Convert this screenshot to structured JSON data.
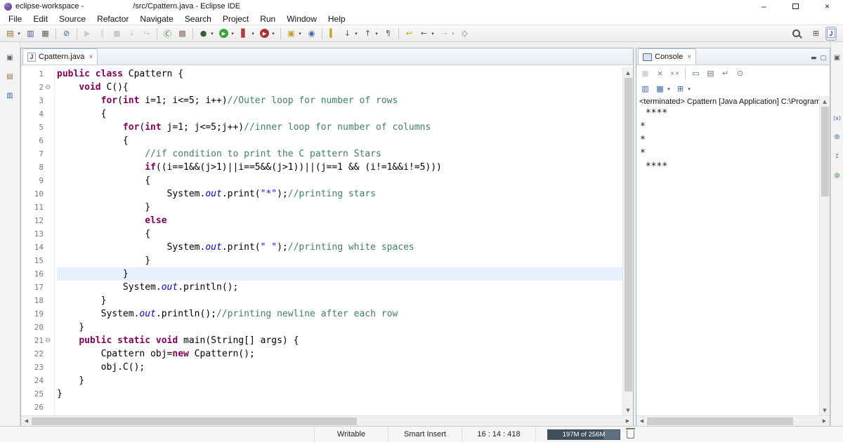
{
  "window": {
    "title_workspace": "eclipse-workspace -",
    "title_file": "/src/Cpattern.java - Eclipse IDE"
  },
  "ui": {
    "dropdown_glyph": "▾",
    "close_glyph": "×",
    "minimize_glyph": "–",
    "up_glyph": "▲",
    "down_glyph": "▼",
    "left_glyph": "◀",
    "right_glyph": "▶",
    "minimize_view_glyph": "▬",
    "maximize_view_glyph": "□",
    "open_perspective_glyph": "⊞",
    "java_glyph": "J"
  },
  "colors": {
    "keyword": "#7f0055",
    "comment": "#3f7f5f",
    "string": "#2a00ff",
    "field": "#0000c0",
    "current_line": "#e6f1fb"
  },
  "menu": {
    "items": [
      "File",
      "Edit",
      "Source",
      "Refactor",
      "Navigate",
      "Search",
      "Project",
      "Run",
      "Window",
      "Help"
    ]
  },
  "toolbar": {
    "buttons": [
      {
        "name": "new-wizard",
        "glyph": "▤",
        "color": "#8a6d2a",
        "dd": true
      },
      {
        "name": "save",
        "glyph": "▥",
        "color": "#4a4a8f"
      },
      {
        "name": "print",
        "glyph": "▦",
        "color": "#5a5a5a"
      },
      {
        "sep": true
      },
      {
        "name": "skip-all-breakpoints",
        "glyph": "⊘",
        "color": "#3465a4"
      },
      {
        "sep": true
      },
      {
        "name": "resume",
        "glyph": "▶",
        "color": "#8f8f8f",
        "disabled": true
      },
      {
        "name": "suspend",
        "glyph": "∥",
        "color": "#8f8f8f",
        "disabled": true
      },
      {
        "name": "terminate",
        "glyph": "■",
        "color": "#8f8f8f",
        "disabled": true
      },
      {
        "name": "step-into",
        "glyph": "↓",
        "color": "#8f8f8f",
        "disabled": true
      },
      {
        "name": "step-over",
        "glyph": "↪",
        "color": "#8f8f8f",
        "disabled": true
      },
      {
        "sep": true
      },
      {
        "name": "new-java-class",
        "glyph": "Ⓒ",
        "color": "#2e7d32"
      },
      {
        "name": "new-java-package",
        "glyph": "▩",
        "color": "#8d6e63"
      },
      {
        "sep": true
      },
      {
        "name": "debug",
        "glyph": "●",
        "color": "#355e3b",
        "dd": true
      },
      {
        "name": "run",
        "glyph": "▶",
        "color": "#ffffff",
        "bg": "#3aa33a",
        "dd": true
      },
      {
        "name": "coverage",
        "glyph": "▋",
        "color": "#b23b3b",
        "dd": true
      },
      {
        "name": "run-external-tools",
        "glyph": "▶",
        "color": "#ffffff",
        "bg": "#aa3333",
        "dd": true
      },
      {
        "sep": true
      },
      {
        "name": "open-task",
        "glyph": "▣",
        "color": "#c49a2a",
        "dd": true
      },
      {
        "name": "search",
        "glyph": "◉",
        "color": "#3465a4"
      },
      {
        "sep": true
      },
      {
        "name": "toggle-mark-occurrences",
        "glyph": "▍",
        "color": "#c8a415"
      },
      {
        "name": "next-annotation",
        "glyph": "↓",
        "color": "#555555",
        "dd": true
      },
      {
        "name": "previous-annotation",
        "glyph": "↑",
        "color": "#555555",
        "dd": true
      },
      {
        "name": "show-whitespace",
        "glyph": "¶",
        "color": "#777777"
      },
      {
        "sep": true
      },
      {
        "name": "last-edit-location",
        "glyph": "↩",
        "color": "#c8a415"
      },
      {
        "name": "back",
        "glyph": "←",
        "color": "#555555",
        "dd": true
      },
      {
        "name": "forward",
        "glyph": "→",
        "color": "#9a9a9a",
        "dd": true,
        "disabled": true
      },
      {
        "name": "pin-editor",
        "glyph": "◇",
        "color": "#777777"
      }
    ]
  },
  "left_strip": {
    "icons": [
      {
        "name": "restore-left-panel",
        "glyph": "▣",
        "color": "#556070"
      },
      {
        "name": "package-explorer",
        "glyph": "▤",
        "color": "#8d6e3f"
      },
      {
        "name": "open-type-hierarchy",
        "glyph": "▥",
        "color": "#3465a4"
      }
    ]
  },
  "right_strip": {
    "icons": [
      {
        "name": "restore-right-panel",
        "glyph": "▣",
        "color": "#556070"
      },
      {
        "sep": true,
        "size": 52
      },
      {
        "name": "variables-view",
        "glyph": "(x)",
        "color": "#3465a4",
        "small": true
      },
      {
        "name": "breakpoints-view",
        "glyph": "⊚",
        "color": "#3465a4"
      },
      {
        "name": "expressions-view",
        "glyph": "Σ",
        "color": "#777777",
        "small": true
      },
      {
        "name": "javadoc-view",
        "glyph": "@",
        "color": "#2a7a2a",
        "small": true
      }
    ]
  },
  "editor": {
    "tab_label": "Cpattern.java",
    "fold_glyph": "⊖",
    "lines": [
      {
        "n": 1,
        "seg": [
          [
            "k",
            "public"
          ],
          [
            "t",
            " "
          ],
          [
            "k",
            "class"
          ],
          [
            "t",
            " Cpattern {"
          ]
        ]
      },
      {
        "n": 2,
        "fold": true,
        "seg": [
          [
            "t",
            "    "
          ],
          [
            "k",
            "void"
          ],
          [
            "t",
            " C(){"
          ]
        ]
      },
      {
        "n": 3,
        "seg": [
          [
            "t",
            "        "
          ],
          [
            "k",
            "for"
          ],
          [
            "t",
            "("
          ],
          [
            "k",
            "int"
          ],
          [
            "t",
            " i=1; i<=5; i++)"
          ],
          [
            "c",
            "//Outer loop for number of rows"
          ]
        ]
      },
      {
        "n": 4,
        "seg": [
          [
            "t",
            "        {"
          ]
        ]
      },
      {
        "n": 5,
        "seg": [
          [
            "t",
            "            "
          ],
          [
            "k",
            "for"
          ],
          [
            "t",
            "("
          ],
          [
            "k",
            "int"
          ],
          [
            "t",
            " j=1; j<=5;j++)"
          ],
          [
            "c",
            "//inner loop for number of columns"
          ]
        ]
      },
      {
        "n": 6,
        "seg": [
          [
            "t",
            "            {"
          ]
        ]
      },
      {
        "n": 7,
        "seg": [
          [
            "t",
            "                "
          ],
          [
            "c",
            "//if condition to print the C pattern Stars"
          ]
        ]
      },
      {
        "n": 8,
        "seg": [
          [
            "t",
            "                "
          ],
          [
            "k",
            "if"
          ],
          [
            "t",
            "((i==1&&(j>1)||i==5&&(j>1))||(j==1 && (i!=1&&i!=5)))"
          ]
        ]
      },
      {
        "n": 9,
        "seg": [
          [
            "t",
            "                {"
          ]
        ]
      },
      {
        "n": 10,
        "seg": [
          [
            "t",
            "                    System."
          ],
          [
            "f",
            "out"
          ],
          [
            "t",
            ".print("
          ],
          [
            "s",
            "\"*\""
          ],
          [
            "t",
            ");"
          ],
          [
            "c",
            "//printing stars"
          ]
        ]
      },
      {
        "n": 11,
        "seg": [
          [
            "t",
            "                }"
          ]
        ]
      },
      {
        "n": 12,
        "seg": [
          [
            "t",
            "                "
          ],
          [
            "k",
            "else"
          ]
        ]
      },
      {
        "n": 13,
        "seg": [
          [
            "t",
            "                {"
          ]
        ]
      },
      {
        "n": 14,
        "seg": [
          [
            "t",
            "                    System."
          ],
          [
            "f",
            "out"
          ],
          [
            "t",
            ".print("
          ],
          [
            "s",
            "\" \""
          ],
          [
            "t",
            ");"
          ],
          [
            "c",
            "//printing white spaces"
          ]
        ]
      },
      {
        "n": 15,
        "seg": [
          [
            "t",
            "                }"
          ]
        ]
      },
      {
        "n": 16,
        "hl": true,
        "seg": [
          [
            "t",
            "            }"
          ]
        ]
      },
      {
        "n": 17,
        "seg": [
          [
            "t",
            "            System."
          ],
          [
            "f",
            "out"
          ],
          [
            "t",
            ".println();"
          ]
        ]
      },
      {
        "n": 18,
        "seg": [
          [
            "t",
            "        }"
          ]
        ]
      },
      {
        "n": 19,
        "seg": [
          [
            "t",
            "        System."
          ],
          [
            "f",
            "out"
          ],
          [
            "t",
            ".println();"
          ],
          [
            "c",
            "//printing newline after each row"
          ]
        ]
      },
      {
        "n": 20,
        "seg": [
          [
            "t",
            "    }"
          ]
        ]
      },
      {
        "n": 21,
        "fold": true,
        "seg": [
          [
            "t",
            "    "
          ],
          [
            "k",
            "public"
          ],
          [
            "t",
            " "
          ],
          [
            "k",
            "static"
          ],
          [
            "t",
            " "
          ],
          [
            "k",
            "void"
          ],
          [
            "t",
            " main(String[] args) {"
          ]
        ]
      },
      {
        "n": 22,
        "seg": [
          [
            "t",
            "        Cpattern obj="
          ],
          [
            "k",
            "new"
          ],
          [
            "t",
            " Cpattern();"
          ]
        ]
      },
      {
        "n": 23,
        "seg": [
          [
            "t",
            "        obj.C();"
          ]
        ]
      },
      {
        "n": 24,
        "seg": [
          [
            "t",
            "    }"
          ]
        ]
      },
      {
        "n": 25,
        "seg": [
          [
            "t",
            "}"
          ]
        ]
      },
      {
        "n": 26,
        "seg": []
      }
    ]
  },
  "console": {
    "tab_label": "Console",
    "status_line": "<terminated> Cpattern [Java Application] C:\\Program",
    "output": [
      " ****",
      "*",
      "*",
      "*",
      " ****"
    ],
    "toolbar": [
      {
        "name": "terminate-launch",
        "glyph": "■",
        "color": "#9a9a9a",
        "disabled": true
      },
      {
        "name": "remove-launch",
        "glyph": "×",
        "color": "#777777"
      },
      {
        "name": "remove-all-launches",
        "glyph": "××",
        "color": "#777777",
        "small": true
      },
      {
        "sep": true
      },
      {
        "name": "clear-console",
        "glyph": "▭",
        "color": "#3465a4"
      },
      {
        "name": "scroll-lock",
        "glyph": "▤",
        "color": "#777777"
      },
      {
        "name": "word-wrap",
        "glyph": "↵",
        "color": "#777777"
      },
      {
        "name": "pin-console",
        "glyph": "⊙",
        "color": "#777777"
      }
    ],
    "toolbar2": [
      {
        "name": "show-console-on-output",
        "glyph": "▥",
        "color": "#3465a4"
      },
      {
        "name": "display-selected-console",
        "glyph": "▦",
        "color": "#3465a4",
        "dd": true
      },
      {
        "name": "open-console",
        "glyph": "⊞",
        "color": "#3465a4",
        "dd": true
      }
    ]
  },
  "statusbar": {
    "writable": "Writable",
    "insert_mode": "Smart Insert",
    "position": "16 : 14 : 418",
    "heap": "197M of 256M",
    "heap_ratio": 0.77
  }
}
